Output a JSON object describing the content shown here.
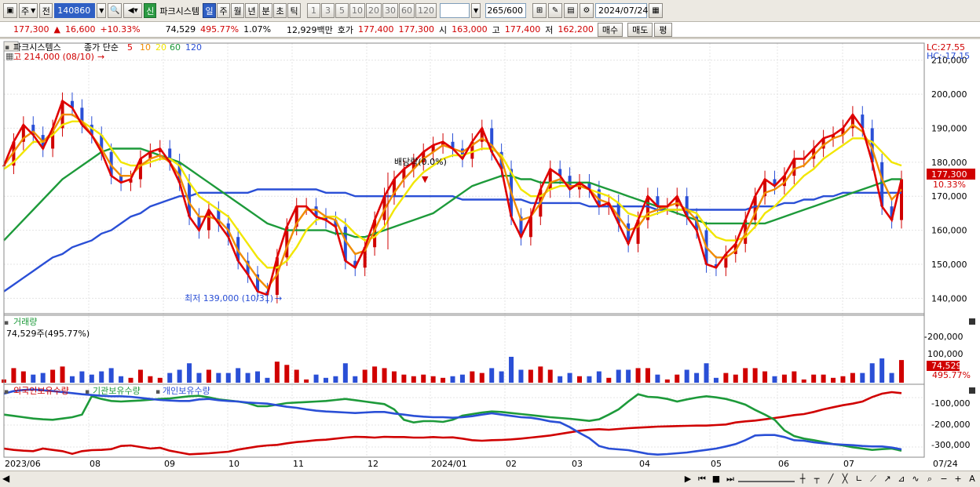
{
  "toolbar": {
    "market": "주",
    "prev": "전",
    "code": "140860",
    "stock_name": "파크시스템",
    "new_badge": "신",
    "periods": [
      {
        "label": "일",
        "active": true
      },
      {
        "label": "주"
      },
      {
        "label": "월"
      },
      {
        "label": "년"
      },
      {
        "label": "분"
      },
      {
        "label": "초"
      },
      {
        "label": "틱"
      }
    ],
    "intervals": [
      "1",
      "3",
      "5",
      "10",
      "20",
      "30",
      "60",
      "120"
    ],
    "count": "265",
    "count_max": "/600",
    "date": "2024/07/24"
  },
  "quote": {
    "price": "177,300",
    "change": "16,600",
    "change_pct": "+10.33%",
    "volume": "74,529",
    "volume_pct": "495.77%",
    "turnover_pct": "1.07%",
    "amount": "12,929백만",
    "bid_label": "호가",
    "bid": "177,400",
    "ask": "177,300",
    "open_label": "시",
    "open": "163,000",
    "high_label": "고",
    "high": "177,400",
    "low_label": "저",
    "low": "162,200",
    "buy_label": "매수",
    "sell_label": "매도",
    "avg_label": "평"
  },
  "price_panel": {
    "title": "파크시스템스",
    "ma_label": "종가 단순",
    "ma_periods": [
      "5",
      "10",
      "20",
      "60",
      "120"
    ],
    "ma_colors": [
      "#e00000",
      "#f08c00",
      "#f2e600",
      "#1d9a3a",
      "#2a4fd6"
    ],
    "high_note": "고 214,000 (08/10)",
    "low_note": "최저 139,000 (10/31)",
    "dividend_note": "배당락(0.0%)",
    "lc": "LC:27.55",
    "hc": "HC:-17.15",
    "price_tag": "177,300",
    "pct_tag": "10.33%",
    "y_ticks": [
      "210,000",
      "200,000",
      "190,000",
      "180,000",
      "170,000",
      "160,000",
      "150,000",
      "140,000"
    ],
    "y_values": [
      210000,
      200000,
      190000,
      180000,
      170000,
      160000,
      150000,
      140000
    ]
  },
  "volume_panel": {
    "title": "거래량",
    "readout": "74,529주(495.77%)",
    "y_ticks": [
      "200,000",
      "100,000"
    ],
    "tag": "74,529",
    "tag_pct": "495.77%"
  },
  "holding_panel": {
    "legend": [
      "외국인보유수량",
      "기관보유수량",
      "개인보유수량"
    ],
    "colors": [
      "#d00000",
      "#1d9a3a",
      "#2a4fd6"
    ],
    "y_ticks": [
      "-100,000",
      "-200,000",
      "-300,000"
    ]
  },
  "x_axis": {
    "labels": [
      "2023/06",
      "08",
      "09",
      "10",
      "11",
      "12",
      "2024/01",
      "02",
      "03",
      "04",
      "05",
      "06",
      "07"
    ],
    "last_date": "07/24"
  },
  "chart_data": {
    "type": "line",
    "date_range": [
      "2023/06",
      "2024/07/24"
    ],
    "price_ylim": [
      135000,
      215000
    ],
    "volume_ylim": [
      0,
      250000
    ],
    "holding_ylim": [
      -330000,
      -60000
    ],
    "series": [
      {
        "name": "5",
        "values": [
          179000,
          186000,
          191000,
          188000,
          184000,
          190000,
          198000,
          196000,
          191000,
          188000,
          183000,
          176000,
          174000,
          175000,
          181000,
          183000,
          184000,
          180000,
          174000,
          164000,
          160000,
          166000,
          162000,
          158000,
          151000,
          147000,
          142000,
          141000,
          152000,
          161000,
          167000,
          167000,
          164000,
          163000,
          161000,
          151000,
          149000,
          155000,
          163000,
          170000,
          175000,
          178000,
          180000,
          183000,
          185000,
          186000,
          184000,
          181000,
          186000,
          190000,
          183000,
          178000,
          164000,
          158000,
          164000,
          172000,
          178000,
          176000,
          172000,
          174000,
          172000,
          167000,
          168000,
          162000,
          156000,
          163000,
          170000,
          167000,
          167000,
          170000,
          164000,
          160000,
          150000,
          149000,
          153000,
          156000,
          163000,
          170000,
          175000,
          173000,
          176000,
          181000,
          181000,
          184000,
          187000,
          188000,
          190000,
          194000,
          190000,
          180000,
          167000,
          163000,
          175000
        ]
      },
      {
        "name": "10",
        "values": [
          179000,
          183000,
          187000,
          189000,
          186000,
          189000,
          194000,
          194000,
          192000,
          188000,
          184000,
          179000,
          176000,
          176000,
          179000,
          181000,
          182000,
          180000,
          176000,
          168000,
          164000,
          164000,
          163000,
          160000,
          154000,
          150000,
          146000,
          143000,
          147000,
          155000,
          162000,
          166000,
          166000,
          164000,
          163000,
          157000,
          153000,
          154000,
          160000,
          166000,
          171000,
          175000,
          178000,
          181000,
          183000,
          185000,
          184000,
          183000,
          185000,
          187000,
          185000,
          181000,
          171000,
          163000,
          164000,
          168000,
          174000,
          175000,
          173000,
          173000,
          172000,
          169000,
          168000,
          164000,
          160000,
          161000,
          165000,
          166000,
          167000,
          168000,
          166000,
          163000,
          155000,
          152000,
          152000,
          154000,
          159000,
          165000,
          171000,
          172000,
          174000,
          178000,
          179000,
          182000,
          185000,
          187000,
          188000,
          191000,
          189000,
          184000,
          175000,
          169000,
          172000
        ]
      },
      {
        "name": "20",
        "values": [
          178000,
          180000,
          183000,
          186000,
          186000,
          188000,
          191000,
          192000,
          192000,
          190000,
          188000,
          184000,
          180000,
          179000,
          179000,
          180000,
          181000,
          181000,
          179000,
          174000,
          170000,
          168000,
          166000,
          164000,
          160000,
          156000,
          152000,
          149000,
          149000,
          151000,
          155000,
          160000,
          163000,
          164000,
          164000,
          162000,
          159000,
          157000,
          158000,
          161000,
          166000,
          170000,
          174000,
          177000,
          179000,
          181000,
          182000,
          182000,
          183000,
          184000,
          184000,
          182000,
          177000,
          172000,
          170000,
          170000,
          172000,
          173000,
          173000,
          173000,
          172000,
          171000,
          170000,
          168000,
          165000,
          164000,
          164000,
          165000,
          166000,
          166000,
          166000,
          165000,
          161000,
          158000,
          157000,
          157000,
          158000,
          161000,
          165000,
          167000,
          170000,
          173000,
          176000,
          178000,
          181000,
          183000,
          185000,
          187000,
          187000,
          186000,
          183000,
          180000,
          179000
        ]
      },
      {
        "name": "60",
        "values": [
          157000,
          160000,
          163000,
          166000,
          169000,
          172000,
          175000,
          177000,
          179000,
          181000,
          183000,
          184000,
          184000,
          184000,
          184000,
          183000,
          182000,
          181000,
          180000,
          178000,
          176000,
          174000,
          172000,
          170000,
          168000,
          166000,
          164000,
          162000,
          161000,
          160000,
          160000,
          160000,
          160000,
          160000,
          159000,
          159000,
          158000,
          158000,
          159000,
          160000,
          161000,
          162000,
          163000,
          164000,
          165000,
          167000,
          169000,
          171000,
          173000,
          174000,
          175000,
          176000,
          176000,
          175000,
          175000,
          174000,
          174000,
          174000,
          174000,
          174000,
          174000,
          173000,
          172000,
          171000,
          170000,
          169000,
          168000,
          167000,
          166000,
          165000,
          164000,
          163000,
          162000,
          162000,
          162000,
          162000,
          162000,
          162000,
          162000,
          163000,
          164000,
          165000,
          166000,
          167000,
          168000,
          169000,
          170000,
          171000,
          172000,
          173000,
          174000,
          175000,
          175000
        ]
      },
      {
        "name": "120",
        "values": [
          142000,
          144000,
          146000,
          148000,
          150000,
          152000,
          153000,
          155000,
          156000,
          157000,
          159000,
          160000,
          162000,
          164000,
          165000,
          167000,
          168000,
          169000,
          170000,
          170000,
          171000,
          171000,
          171000,
          171000,
          171000,
          171000,
          172000,
          172000,
          172000,
          172000,
          172000,
          172000,
          172000,
          171000,
          171000,
          171000,
          170000,
          170000,
          170000,
          170000,
          170000,
          170000,
          170000,
          170000,
          170000,
          170000,
          170000,
          169000,
          169000,
          169000,
          169000,
          169000,
          169000,
          169000,
          168000,
          168000,
          168000,
          168000,
          168000,
          168000,
          167000,
          167000,
          167000,
          167000,
          167000,
          167000,
          167000,
          166000,
          166000,
          166000,
          166000,
          166000,
          166000,
          166000,
          166000,
          166000,
          166000,
          167000,
          167000,
          167000,
          168000,
          168000,
          169000,
          169000,
          170000,
          170000,
          171000,
          171000,
          171000,
          171000,
          171000,
          171000,
          171000
        ]
      },
      {
        "name": "외국인보유수량",
        "values": [
          -300000,
          -305000,
          -308000,
          -310000,
          -300000,
          -305000,
          -310000,
          -320000,
          -310000,
          -306000,
          -305000,
          -302000,
          -290000,
          -288000,
          -294000,
          -300000,
          -297000,
          -308000,
          -315000,
          -322000,
          -320000,
          -318000,
          -315000,
          -312000,
          -304000,
          -298000,
          -292000,
          -288000,
          -286000,
          -280000,
          -275000,
          -272000,
          -268000,
          -266000,
          -262000,
          -258000,
          -255000,
          -256000,
          -258000,
          -255000,
          -256000,
          -256000,
          -258000,
          -258000,
          -256000,
          -258000,
          -257000,
          -262000,
          -268000,
          -270000,
          -268000,
          -267000,
          -265000,
          -262000,
          -258000,
          -254000,
          -250000,
          -244000,
          -238000,
          -232000,
          -228000,
          -226000,
          -228000,
          -225000,
          -222000,
          -220000,
          -218000,
          -216000,
          -215000,
          -214000,
          -213000,
          -212000,
          -212000,
          -210000,
          -208000,
          -200000,
          -196000,
          -193000,
          -188000,
          -183000,
          -178000,
          -172000,
          -168000,
          -160000,
          -150000,
          -142000,
          -134000,
          -128000,
          -120000,
          -103000,
          -90000,
          -84000,
          -88000
        ]
      },
      {
        "name": "기관보유수량",
        "values": [
          -170000,
          -175000,
          -180000,
          -185000,
          -188000,
          -190000,
          -185000,
          -180000,
          -170000,
          -100000,
          -110000,
          -118000,
          -120000,
          -118000,
          -116000,
          -113000,
          -110000,
          -108000,
          -104000,
          -100000,
          -98000,
          -104000,
          -112000,
          -116000,
          -120000,
          -126000,
          -138000,
          -138000,
          -132000,
          -126000,
          -124000,
          -122000,
          -120000,
          -118000,
          -114000,
          -110000,
          -115000,
          -120000,
          -125000,
          -130000,
          -150000,
          -190000,
          -200000,
          -195000,
          -195000,
          -198000,
          -190000,
          -174000,
          -168000,
          -162000,
          -158000,
          -160000,
          -164000,
          -168000,
          -172000,
          -176000,
          -180000,
          -183000,
          -186000,
          -190000,
          -194000,
          -188000,
          -170000,
          -150000,
          -120000,
          -92000,
          -102000,
          -104000,
          -110000,
          -120000,
          -112000,
          -105000,
          -100000,
          -104000,
          -110000,
          -120000,
          -132000,
          -152000,
          -170000,
          -190000,
          -230000,
          -252000,
          -262000,
          -268000,
          -275000,
          -283000,
          -288000,
          -295000,
          -300000,
          -305000,
          -302000,
          -300000,
          -308000
        ]
      },
      {
        "name": "개인보유수량",
        "values": [
          -90000,
          -80000,
          -76000,
          -74000,
          -77000,
          -80000,
          -84000,
          -88000,
          -92000,
          -95000,
          -98000,
          -100000,
          -100000,
          -102000,
          -106000,
          -110000,
          -114000,
          -116000,
          -118000,
          -118000,
          -112000,
          -110000,
          -115000,
          -118000,
          -120000,
          -124000,
          -126000,
          -128000,
          -134000,
          -140000,
          -144000,
          -150000,
          -155000,
          -158000,
          -160000,
          -162000,
          -164000,
          -162000,
          -160000,
          -160000,
          -166000,
          -170000,
          -175000,
          -178000,
          -180000,
          -180000,
          -182000,
          -180000,
          -176000,
          -170000,
          -165000,
          -170000,
          -175000,
          -180000,
          -182000,
          -188000,
          -196000,
          -200000,
          -218000,
          -240000,
          -260000,
          -290000,
          -300000,
          -303000,
          -306000,
          -313000,
          -320000,
          -323000,
          -321000,
          -318000,
          -315000,
          -310000,
          -305000,
          -300000,
          -292000,
          -283000,
          -268000,
          -250000,
          -248000,
          -248000,
          -256000,
          -268000,
          -270000,
          -276000,
          -280000,
          -283000,
          -285000,
          -287000,
          -290000,
          -292000,
          -292000,
          -296000,
          -303000
        ]
      }
    ]
  }
}
